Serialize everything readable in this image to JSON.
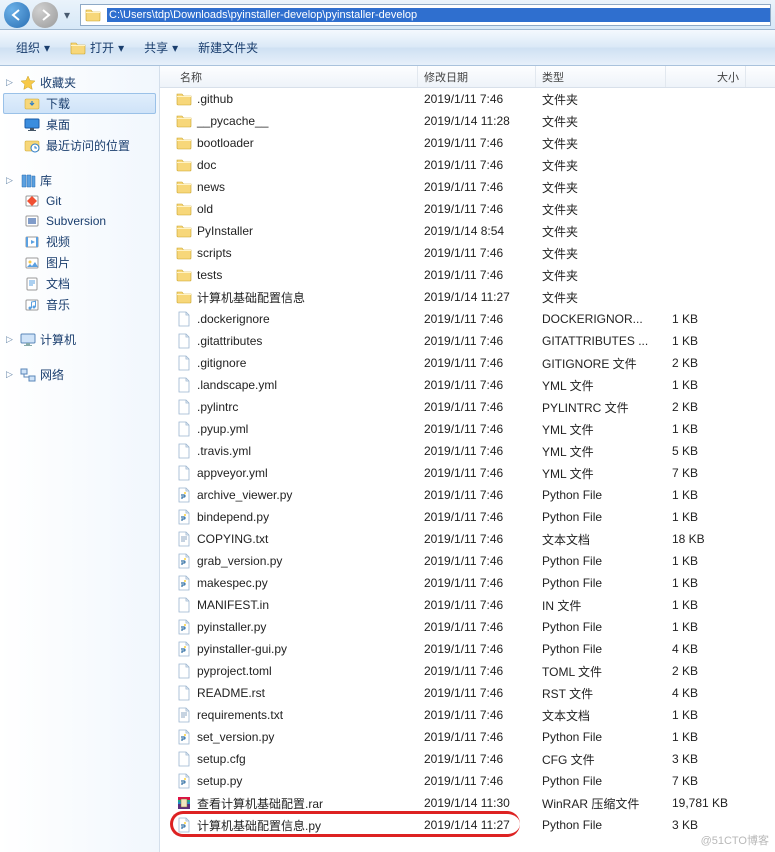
{
  "address_path": "C:\\Users\\tdp\\Downloads\\pyinstaller-develop\\pyinstaller-develop",
  "toolbar": {
    "organize": "组织",
    "open": "打开",
    "share": "共享",
    "newfolder": "新建文件夹"
  },
  "sidebar": {
    "favorites": {
      "label": "收藏夹",
      "items": [
        {
          "label": "下载",
          "icon": "download"
        },
        {
          "label": "桌面",
          "icon": "desktop"
        },
        {
          "label": "最近访问的位置",
          "icon": "recent"
        }
      ]
    },
    "libraries": {
      "label": "库",
      "items": [
        {
          "label": "Git",
          "icon": "git"
        },
        {
          "label": "Subversion",
          "icon": "svn"
        },
        {
          "label": "视频",
          "icon": "video"
        },
        {
          "label": "图片",
          "icon": "pictures"
        },
        {
          "label": "文档",
          "icon": "docs"
        },
        {
          "label": "音乐",
          "icon": "music"
        }
      ]
    },
    "computer": {
      "label": "计算机"
    },
    "network": {
      "label": "网络"
    }
  },
  "columns": {
    "name": "名称",
    "date": "修改日期",
    "type": "类型",
    "size": "大小"
  },
  "files": [
    {
      "name": ".github",
      "date": "2019/1/11 7:46",
      "type": "文件夹",
      "size": "",
      "icon": "folder"
    },
    {
      "name": "__pycache__",
      "date": "2019/1/14 11:28",
      "type": "文件夹",
      "size": "",
      "icon": "folder"
    },
    {
      "name": "bootloader",
      "date": "2019/1/11 7:46",
      "type": "文件夹",
      "size": "",
      "icon": "folder"
    },
    {
      "name": "doc",
      "date": "2019/1/11 7:46",
      "type": "文件夹",
      "size": "",
      "icon": "folder"
    },
    {
      "name": "news",
      "date": "2019/1/11 7:46",
      "type": "文件夹",
      "size": "",
      "icon": "folder"
    },
    {
      "name": "old",
      "date": "2019/1/11 7:46",
      "type": "文件夹",
      "size": "",
      "icon": "folder"
    },
    {
      "name": "PyInstaller",
      "date": "2019/1/14 8:54",
      "type": "文件夹",
      "size": "",
      "icon": "folder"
    },
    {
      "name": "scripts",
      "date": "2019/1/11 7:46",
      "type": "文件夹",
      "size": "",
      "icon": "folder"
    },
    {
      "name": "tests",
      "date": "2019/1/11 7:46",
      "type": "文件夹",
      "size": "",
      "icon": "folder"
    },
    {
      "name": "计算机基础配置信息",
      "date": "2019/1/14 11:27",
      "type": "文件夹",
      "size": "",
      "icon": "folder"
    },
    {
      "name": ".dockerignore",
      "date": "2019/1/11 7:46",
      "type": "DOCKERIGNOR...",
      "size": "1 KB",
      "icon": "file"
    },
    {
      "name": ".gitattributes",
      "date": "2019/1/11 7:46",
      "type": "GITATTRIBUTES ...",
      "size": "1 KB",
      "icon": "file"
    },
    {
      "name": ".gitignore",
      "date": "2019/1/11 7:46",
      "type": "GITIGNORE 文件",
      "size": "2 KB",
      "icon": "file"
    },
    {
      "name": ".landscape.yml",
      "date": "2019/1/11 7:46",
      "type": "YML 文件",
      "size": "1 KB",
      "icon": "file"
    },
    {
      "name": ".pylintrc",
      "date": "2019/1/11 7:46",
      "type": "PYLINTRC 文件",
      "size": "2 KB",
      "icon": "file"
    },
    {
      "name": ".pyup.yml",
      "date": "2019/1/11 7:46",
      "type": "YML 文件",
      "size": "1 KB",
      "icon": "file"
    },
    {
      "name": ".travis.yml",
      "date": "2019/1/11 7:46",
      "type": "YML 文件",
      "size": "5 KB",
      "icon": "file"
    },
    {
      "name": "appveyor.yml",
      "date": "2019/1/11 7:46",
      "type": "YML 文件",
      "size": "7 KB",
      "icon": "file"
    },
    {
      "name": "archive_viewer.py",
      "date": "2019/1/11 7:46",
      "type": "Python File",
      "size": "1 KB",
      "icon": "py"
    },
    {
      "name": "bindepend.py",
      "date": "2019/1/11 7:46",
      "type": "Python File",
      "size": "1 KB",
      "icon": "py"
    },
    {
      "name": "COPYING.txt",
      "date": "2019/1/11 7:46",
      "type": "文本文档",
      "size": "18 KB",
      "icon": "txt"
    },
    {
      "name": "grab_version.py",
      "date": "2019/1/11 7:46",
      "type": "Python File",
      "size": "1 KB",
      "icon": "py"
    },
    {
      "name": "makespec.py",
      "date": "2019/1/11 7:46",
      "type": "Python File",
      "size": "1 KB",
      "icon": "py"
    },
    {
      "name": "MANIFEST.in",
      "date": "2019/1/11 7:46",
      "type": "IN 文件",
      "size": "1 KB",
      "icon": "file"
    },
    {
      "name": "pyinstaller.py",
      "date": "2019/1/11 7:46",
      "type": "Python File",
      "size": "1 KB",
      "icon": "py"
    },
    {
      "name": "pyinstaller-gui.py",
      "date": "2019/1/11 7:46",
      "type": "Python File",
      "size": "4 KB",
      "icon": "py"
    },
    {
      "name": "pyproject.toml",
      "date": "2019/1/11 7:46",
      "type": "TOML 文件",
      "size": "2 KB",
      "icon": "file"
    },
    {
      "name": "README.rst",
      "date": "2019/1/11 7:46",
      "type": "RST 文件",
      "size": "4 KB",
      "icon": "file"
    },
    {
      "name": "requirements.txt",
      "date": "2019/1/11 7:46",
      "type": "文本文档",
      "size": "1 KB",
      "icon": "txt"
    },
    {
      "name": "set_version.py",
      "date": "2019/1/11 7:46",
      "type": "Python File",
      "size": "1 KB",
      "icon": "py"
    },
    {
      "name": "setup.cfg",
      "date": "2019/1/11 7:46",
      "type": "CFG 文件",
      "size": "3 KB",
      "icon": "file"
    },
    {
      "name": "setup.py",
      "date": "2019/1/11 7:46",
      "type": "Python File",
      "size": "7 KB",
      "icon": "py"
    },
    {
      "name": "查看计算机基础配置.rar",
      "date": "2019/1/14 11:30",
      "type": "WinRAR 压缩文件",
      "size": "19,781 KB",
      "icon": "rar"
    },
    {
      "name": "计算机基础配置信息.py",
      "date": "2019/1/14 11:27",
      "type": "Python File",
      "size": "3 KB",
      "icon": "py",
      "highlight": true
    }
  ],
  "watermark": "@51CTO博客"
}
